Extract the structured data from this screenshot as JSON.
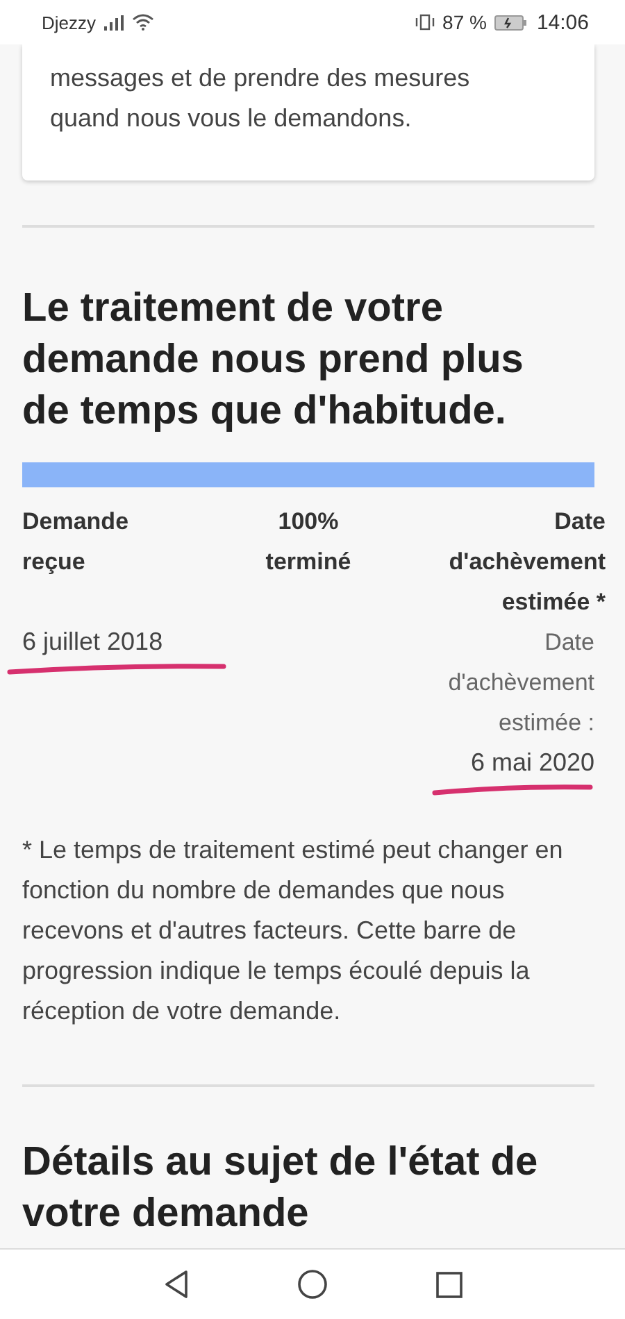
{
  "status_bar": {
    "carrier": "Djezzy",
    "battery": "87 %",
    "time": "14:06"
  },
  "notice_card": {
    "text": "messages et de prendre des mesures quand nous vous le demandons."
  },
  "progress_section": {
    "heading": "Le traitement de votre demande nous prend plus de temps que d'habitude.",
    "level": 1,
    "columns": [
      {
        "label": "Demande reçue",
        "value": "6 juillet 2018",
        "annotated": true
      },
      {
        "label": "100% terminé"
      },
      {
        "label": "Date d'achèvement estimée *",
        "caption": "Date d'achèvement estimée :",
        "value": "6 mai 2020",
        "annotated": true
      }
    ],
    "footnote": "* Le temps de traitement estimé peut changer en fonction du nombre de demandes que nous recevons et d'autres facteurs. Cette barre de progression indique le temps écoulé depuis la réception de votre demande."
  },
  "details_section": {
    "heading": "Détails au sujet de l'état de votre demande"
  }
}
